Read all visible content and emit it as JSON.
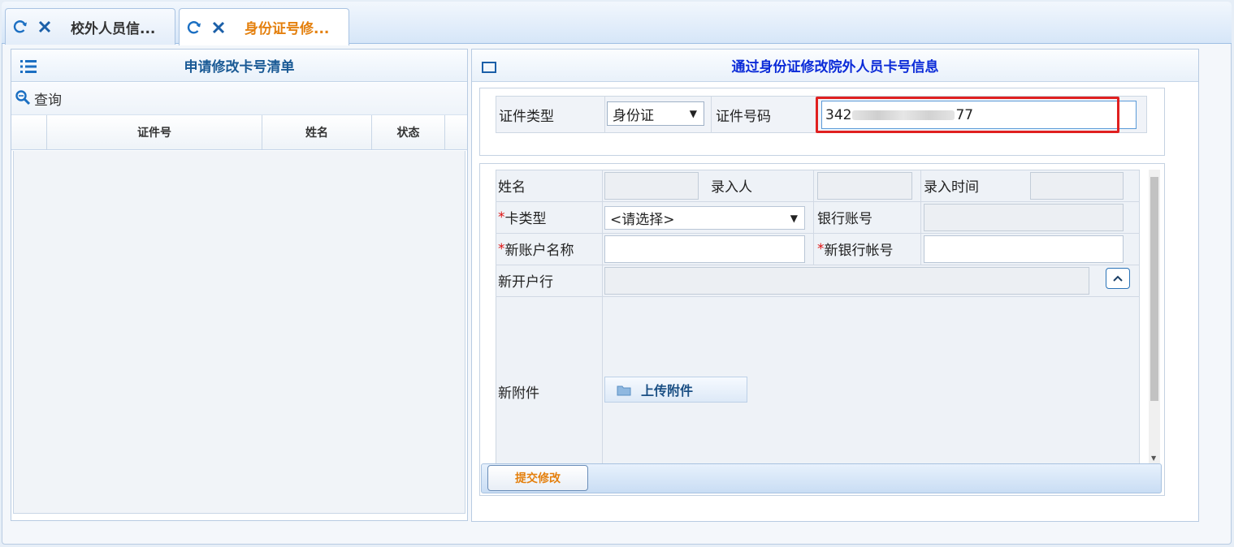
{
  "tabs": [
    {
      "label": "校外人员信..."
    },
    {
      "label": "身份证号修..."
    }
  ],
  "left_panel": {
    "title": "申请修改卡号清单",
    "query_label": "查询",
    "columns": [
      "",
      "证件号",
      "姓名",
      "状态",
      ""
    ]
  },
  "right_panel": {
    "title": "通过身份证修改院外人员卡号信息",
    "id_type_label": "证件类型",
    "id_type_value": "身份证",
    "id_number_label": "证件号码",
    "id_number_prefix": "342",
    "id_number_suffix": "77",
    "name_label": "姓名",
    "recorder_label": "录入人",
    "record_time_label": "录入时间",
    "card_type_label": "卡类型",
    "card_type_value": "<请选择>",
    "bank_account_label": "银行账号",
    "new_account_name_label": "新账户名称",
    "new_bank_account_label": "新银行帐号",
    "new_bank_label": "新开户行",
    "new_attachment_label": "新附件",
    "upload_label": "上传附件",
    "submit_label": "提交修改",
    "required_mark": "*"
  },
  "colors": {
    "accent_orange": "#e4800e",
    "title_blue": "#0b2bd8",
    "highlight_red": "#e02020"
  }
}
